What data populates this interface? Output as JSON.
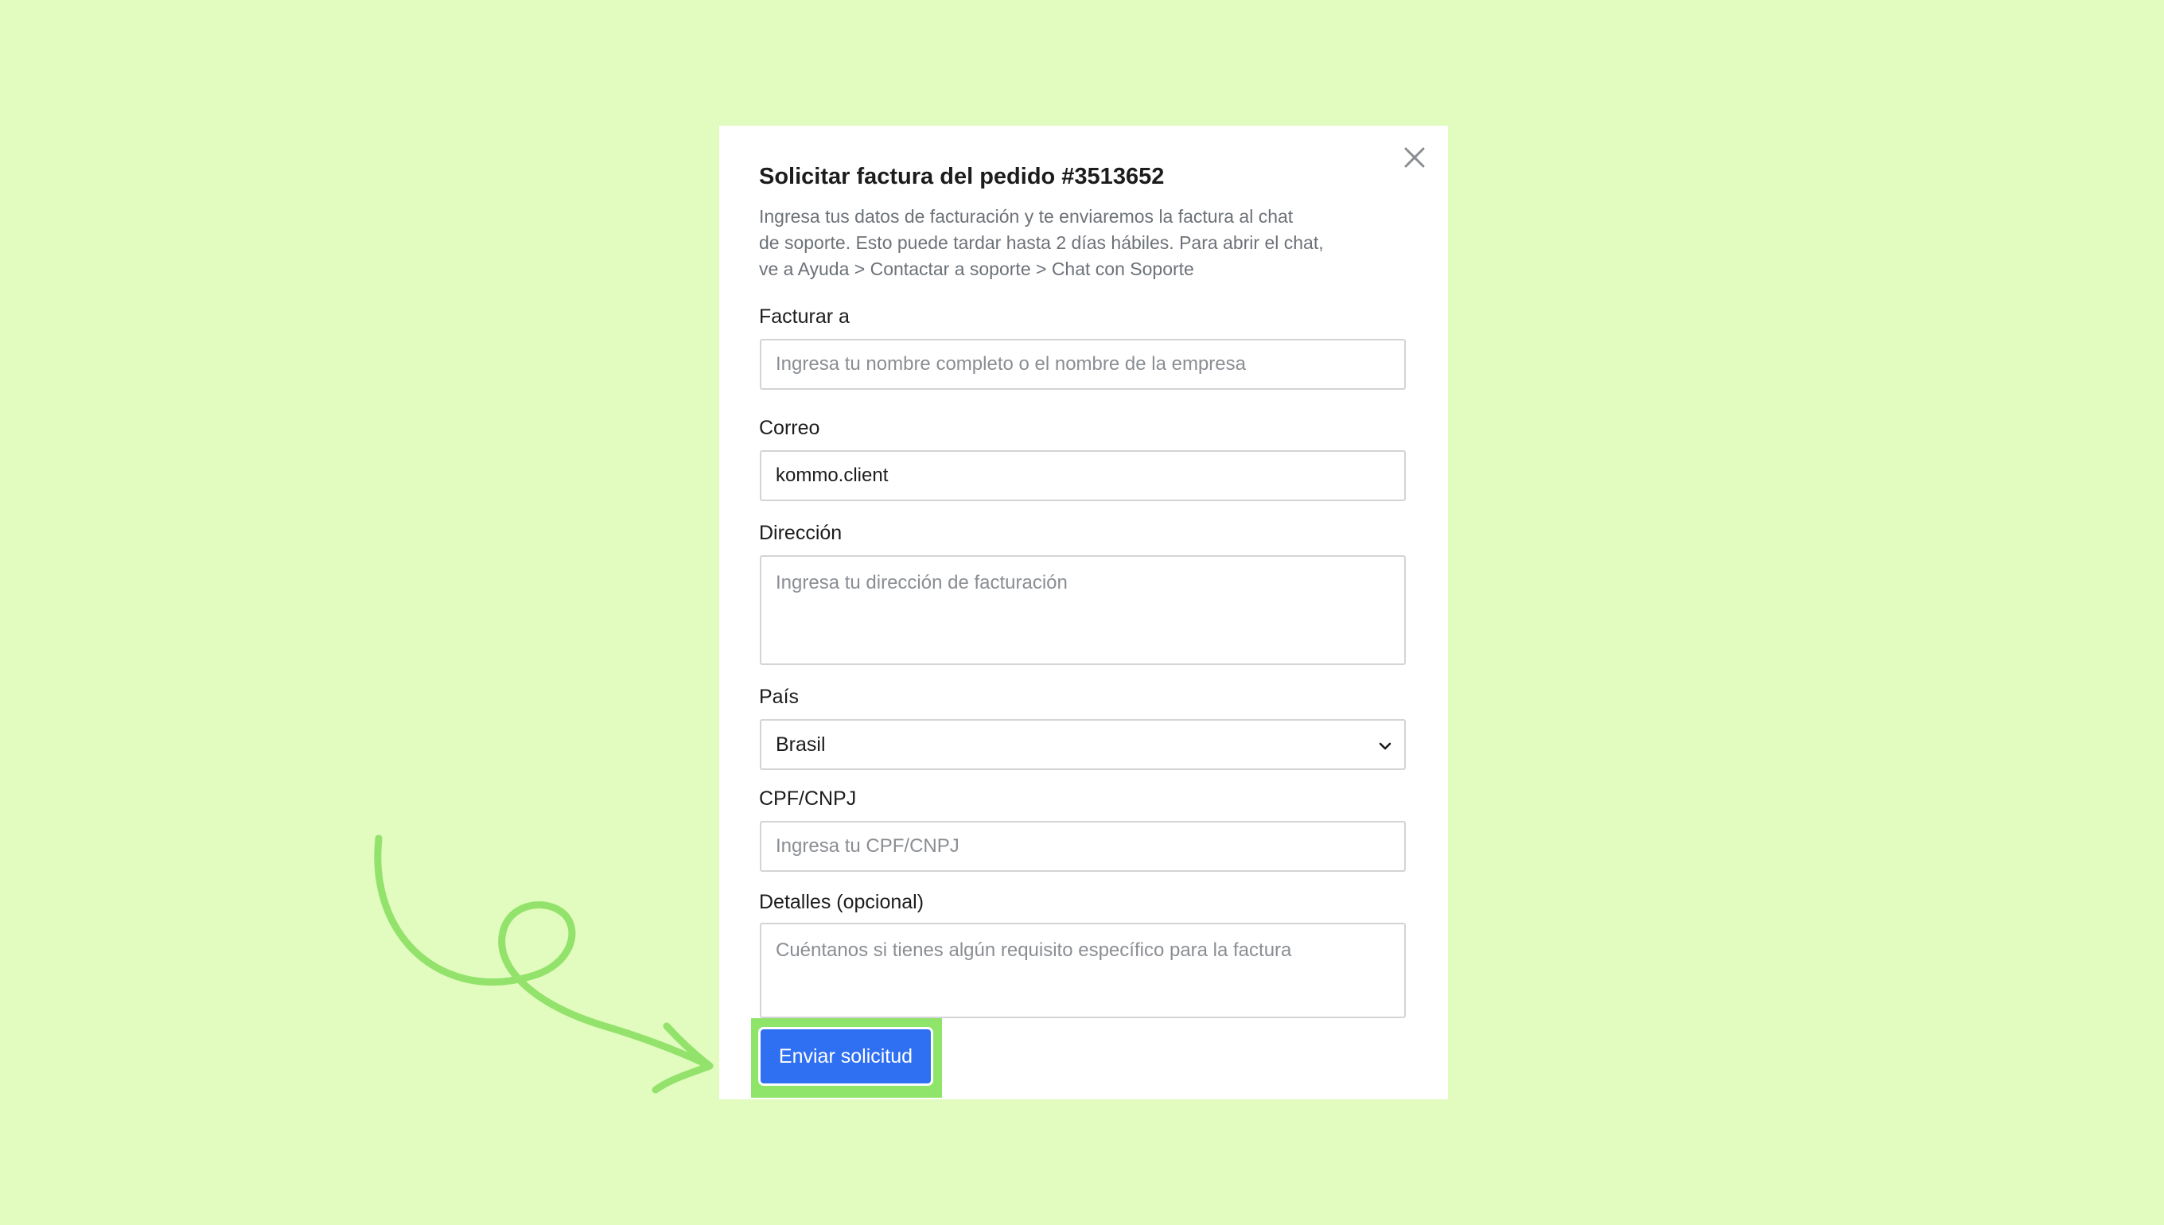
{
  "modal": {
    "title": "Solicitar factura del pedido #3513652",
    "description_lines": [
      "Ingresa tus datos de facturación y te enviaremos la factura al chat",
      "de soporte. Esto puede tardar hasta 2 días hábiles. Para abrir el chat,",
      "ve a Ayuda > Contactar a soporte > Chat con Soporte"
    ],
    "fields": {
      "bill_to": {
        "label": "Facturar a",
        "value": "",
        "placeholder": "Ingresa tu nombre completo o el nombre de la empresa"
      },
      "email": {
        "label": "Correo",
        "value": "kommo.client",
        "placeholder": ""
      },
      "address": {
        "label": "Dirección",
        "value": "",
        "placeholder": "Ingresa tu dirección de facturación"
      },
      "country": {
        "label": "País",
        "selected": "Brasil"
      },
      "tax_id": {
        "label": "CPF/CNPJ",
        "value": "",
        "placeholder": "Ingresa tu CPF/CNPJ"
      },
      "details": {
        "label": "Detalles (opcional)",
        "value": "",
        "placeholder": "Cuéntanos si tienes algún requisito específico para la factura"
      }
    },
    "submit_label": "Enviar solicitud"
  },
  "colors": {
    "background": "#e1fcbe",
    "highlight": "#8fe46a",
    "primary_button": "#2f6ff2"
  },
  "icons": {
    "close": "close-icon",
    "dropdown": "chevron-down-icon",
    "annotation": "curly-arrow-icon"
  }
}
